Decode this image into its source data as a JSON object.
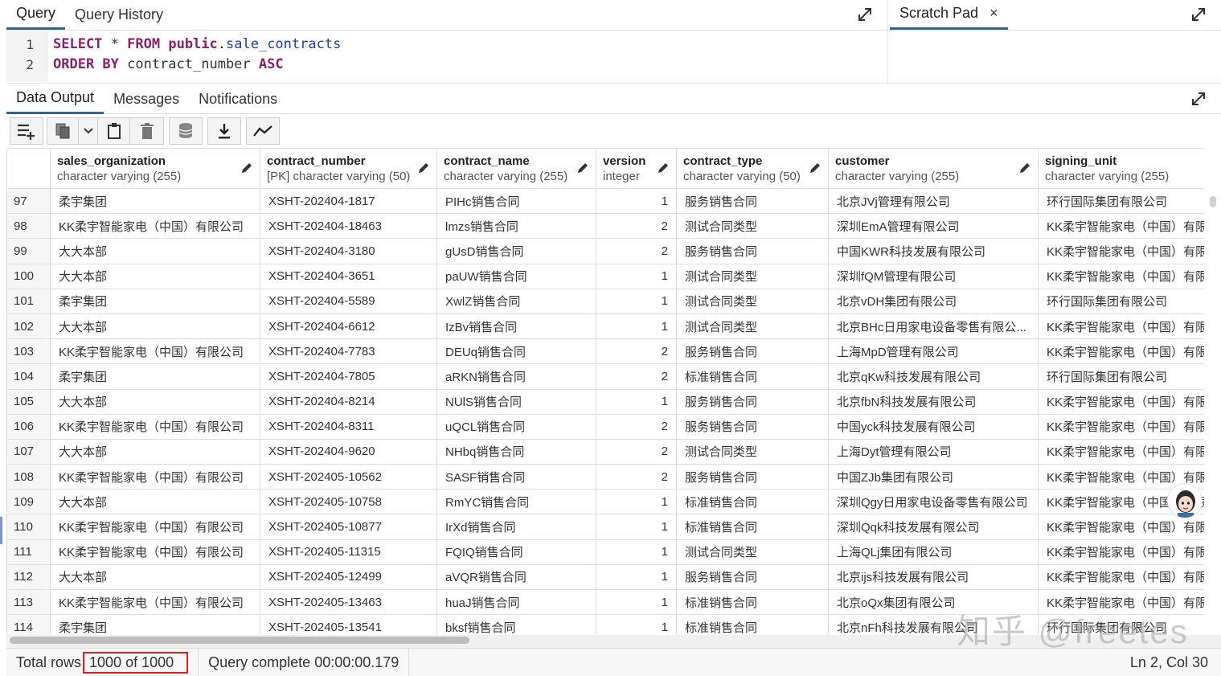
{
  "query_panel": {
    "tabs": [
      "Query",
      "Query History"
    ],
    "code_lines": [
      {
        "num": "1",
        "parts": [
          [
            "kw",
            "SELECT"
          ],
          [
            "t",
            " * "
          ],
          [
            "kw",
            "FROM"
          ],
          [
            "t",
            " "
          ],
          [
            "kw",
            "public"
          ],
          [
            "t",
            "."
          ],
          [
            "tbl",
            "sale_contracts"
          ]
        ]
      },
      {
        "num": "2",
        "parts": [
          [
            "kw",
            "ORDER BY"
          ],
          [
            "t",
            " contract_number "
          ],
          [
            "kw",
            "ASC"
          ]
        ]
      }
    ]
  },
  "scratch_pad": {
    "title": "Scratch Pad",
    "close": "×"
  },
  "result_tabs": [
    "Data Output",
    "Messages",
    "Notifications"
  ],
  "columns": [
    {
      "name": "sales_organization",
      "type": "character varying (255)"
    },
    {
      "name": "contract_number",
      "type": "[PK] character varying (50)"
    },
    {
      "name": "contract_name",
      "type": "character varying (255)"
    },
    {
      "name": "version",
      "type": "integer"
    },
    {
      "name": "contract_type",
      "type": "character varying (50)"
    },
    {
      "name": "customer",
      "type": "character varying (255)"
    },
    {
      "name": "signing_unit",
      "type": "character varying (255)"
    }
  ],
  "rows": [
    [
      "97",
      "柔宇集团",
      "XSHT-202404-1817",
      "PIHc销售合同",
      "1",
      "服务销售合同",
      "北京JVj管理有限公司",
      "环行国际集团有限公司"
    ],
    [
      "98",
      "KK柔宇智能家电（中国）有限公司",
      "XSHT-202404-18463",
      "lmzs销售合同",
      "2",
      "测试合同类型",
      "深圳EmA管理有限公司",
      "KK柔宇智能家电（中国）有限公司"
    ],
    [
      "99",
      "大大本部",
      "XSHT-202404-3180",
      "gUsD销售合同",
      "2",
      "服务销售合同",
      "中国KWR科技发展有限公司",
      "KK柔宇智能家电（中国）有限公司"
    ],
    [
      "100",
      "大大本部",
      "XSHT-202404-3651",
      "paUW销售合同",
      "1",
      "测试合同类型",
      "深圳fQM管理有限公司",
      "KK柔宇智能家电（中国）有限公司"
    ],
    [
      "101",
      "柔宇集团",
      "XSHT-202404-5589",
      "XwlZ销售合同",
      "1",
      "测试合同类型",
      "北京vDH集团有限公司",
      "环行国际集团有限公司"
    ],
    [
      "102",
      "大大本部",
      "XSHT-202404-6612",
      "IzBv销售合同",
      "1",
      "测试合同类型",
      "北京BHc日用家电设备零售有限公...",
      "KK柔宇智能家电（中国）有限公司"
    ],
    [
      "103",
      "KK柔宇智能家电（中国）有限公司",
      "XSHT-202404-7783",
      "DEUq销售合同",
      "2",
      "服务销售合同",
      "上海MpD管理有限公司",
      "KK柔宇智能家电（中国）有限公司"
    ],
    [
      "104",
      "柔宇集团",
      "XSHT-202404-7805",
      "aRKN销售合同",
      "2",
      "标准销售合同",
      "北京qKw科技发展有限公司",
      "环行国际集团有限公司"
    ],
    [
      "105",
      "大大本部",
      "XSHT-202404-8214",
      "NUlS销售合同",
      "1",
      "服务销售合同",
      "北京fbN科技发展有限公司",
      "KK柔宇智能家电（中国）有限公司"
    ],
    [
      "106",
      "KK柔宇智能家电（中国）有限公司",
      "XSHT-202404-8311",
      "uQCL销售合同",
      "2",
      "服务销售合同",
      "中国yck科技发展有限公司",
      "KK柔宇智能家电（中国）有限公司"
    ],
    [
      "107",
      "大大本部",
      "XSHT-202404-9620",
      "NHbq销售合同",
      "2",
      "测试合同类型",
      "上海Dyt管理有限公司",
      "KK柔宇智能家电（中国）有限公司"
    ],
    [
      "108",
      "KK柔宇智能家电（中国）有限公司",
      "XSHT-202405-10562",
      "SASF销售合同",
      "2",
      "服务销售合同",
      "中国ZJb集团有限公司",
      "KK柔宇智能家电（中国）有限公司"
    ],
    [
      "109",
      "大大本部",
      "XSHT-202405-10758",
      "RmYC销售合同",
      "1",
      "标准销售合同",
      "深圳Qgy日用家电设备零售有限公司",
      "KK柔宇智能家电（中国）有限公司"
    ],
    [
      "110",
      "KK柔宇智能家电（中国）有限公司",
      "XSHT-202405-10877",
      "IrXd销售合同",
      "1",
      "标准销售合同",
      "深圳Qqk科技发展有限公司",
      "KK柔宇智能家电（中国）有限公司"
    ],
    [
      "111",
      "KK柔宇智能家电（中国）有限公司",
      "XSHT-202405-11315",
      "FQIQ销售合同",
      "1",
      "测试合同类型",
      "上海QLj集团有限公司",
      "KK柔宇智能家电（中国）有限公司"
    ],
    [
      "112",
      "大大本部",
      "XSHT-202405-12499",
      "aVQR销售合同",
      "1",
      "服务销售合同",
      "北京ijs科技发展有限公司",
      "KK柔宇智能家电（中国）有限公司"
    ],
    [
      "113",
      "KK柔宇智能家电（中国）有限公司",
      "XSHT-202405-13463",
      "huaJ销售合同",
      "1",
      "标准销售合同",
      "北京oQx集团有限公司",
      "KK柔宇智能家电（中国）有限公司"
    ],
    [
      "114",
      "柔宇集团",
      "XSHT-202405-13541",
      "bksf销售合同",
      "1",
      "标准销售合同",
      "北京nFh科技发展有限公司",
      "环行国际集团有限公司"
    ]
  ],
  "status": {
    "total_rows_label": "Total rows",
    "total_rows_value": "1000 of 1000",
    "query_complete": "Query complete 00:00:00.179",
    "cursor": "Ln 2, Col 30"
  },
  "watermark": "知乎 @freetes",
  "accent_color": "#326690",
  "highlight_color": "#e02020",
  "toolbar_icons": [
    "add-row-icon",
    "copy-icon",
    "dropdown-chevron-icon",
    "paste-icon",
    "delete-icon",
    "save-data-icon",
    "download-icon",
    "graph-icon"
  ]
}
